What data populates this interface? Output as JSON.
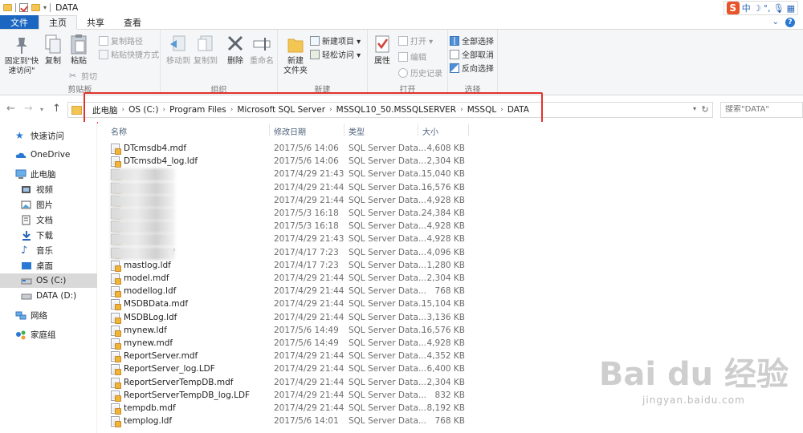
{
  "window": {
    "title": "DATA"
  },
  "tabs": [
    {
      "label": "文件"
    },
    {
      "label": "主页"
    },
    {
      "label": "共享"
    },
    {
      "label": "查看"
    }
  ],
  "ribbon": {
    "clipboard": {
      "label": "剪贴板",
      "pin": "固定到\"快速访问\"",
      "copy": "复制",
      "paste": "粘贴",
      "copy_path": "复制路径",
      "paste_shortcut": "粘贴快捷方式",
      "cut": "剪切"
    },
    "organize": {
      "label": "组织",
      "move_to": "移动到",
      "copy_to": "复制到",
      "delete": "删除",
      "rename": "重命名"
    },
    "new": {
      "label": "新建",
      "new_folder": "新建\n文件夹",
      "new_item": "新建项目 ▾",
      "easy_access": "轻松访问 ▾"
    },
    "open": {
      "label": "打开",
      "properties": "属性",
      "open": "打开 ▾",
      "edit": "编辑",
      "history": "历史记录"
    },
    "select": {
      "label": "选择",
      "select_all": "全部选择",
      "select_none": "全部取消",
      "invert": "反向选择"
    }
  },
  "address": {
    "crumbs": [
      "此电脑",
      "OS (C:)",
      "Program Files",
      "Microsoft SQL Server",
      "MSSQL10_50.MSSQLSERVER",
      "MSSQL",
      "DATA"
    ]
  },
  "search": {
    "placeholder": "搜索\"DATA\""
  },
  "sidebar": {
    "items": [
      {
        "label": "快速访问",
        "icon": "star-icon"
      },
      {
        "label": "OneDrive",
        "icon": "cloud-icon"
      },
      {
        "label": "此电脑",
        "icon": "computer-icon"
      },
      {
        "label": "视频",
        "icon": "video-icon"
      },
      {
        "label": "图片",
        "icon": "picture-icon"
      },
      {
        "label": "文档",
        "icon": "document-icon"
      },
      {
        "label": "下载",
        "icon": "download-icon"
      },
      {
        "label": "音乐",
        "icon": "music-icon"
      },
      {
        "label": "桌面",
        "icon": "desktop-icon"
      },
      {
        "label": "OS (C:)",
        "icon": "drive-icon"
      },
      {
        "label": "DATA (D:)",
        "icon": "drive-icon"
      },
      {
        "label": "网络",
        "icon": "network-icon"
      },
      {
        "label": "家庭组",
        "icon": "homegroup-icon"
      }
    ]
  },
  "list": {
    "columns": {
      "name": "名称",
      "date": "修改日期",
      "type": "类型",
      "size": "大小"
    },
    "rows": [
      {
        "name": "DTcmsdb4.mdf",
        "date": "2017/5/6 14:06",
        "type": "SQL Server Data...",
        "size": "4,608 KB"
      },
      {
        "name": "DTcmsdb4_log.ldf",
        "date": "2017/5/6 14:06",
        "type": "SQL Server Data...",
        "size": "2,304 KB"
      },
      {
        "name": "ldf",
        "date": "2017/4/29 21:43",
        "type": "SQL Server Data...",
        "size": "15,040 KB",
        "blurred": true
      },
      {
        "name": "",
        "date": "2017/4/29 21:44",
        "type": "SQL Server Data...",
        "size": "16,576 KB",
        "blurred": true
      },
      {
        "name": "",
        "date": "2017/4/29 21:44",
        "type": "SQL Server Data...",
        "size": "4,928 KB",
        "blurred": true
      },
      {
        "name": "",
        "date": "2017/5/3 16:18",
        "type": "SQL Server Data...",
        "size": "24,384 KB",
        "blurred": true
      },
      {
        "name": "",
        "date": "2017/5/3 16:18",
        "type": "SQL Server Data...",
        "size": "4,928 KB",
        "blurred": true
      },
      {
        "name": "mdf",
        "date": "2017/4/29 21:43",
        "type": "SQL Server Data...",
        "size": "4,928 KB",
        "blurred": true
      },
      {
        "name": "ter.mdf",
        "date": "2017/4/17 7:23",
        "type": "SQL Server Data...",
        "size": "4,096 KB",
        "blurred": true
      },
      {
        "name": "mastlog.ldf",
        "date": "2017/4/17 7:23",
        "type": "SQL Server Data...",
        "size": "1,280 KB"
      },
      {
        "name": "model.mdf",
        "date": "2017/4/29 21:44",
        "type": "SQL Server Data...",
        "size": "2,304 KB"
      },
      {
        "name": "modellog.ldf",
        "date": "2017/4/29 21:44",
        "type": "SQL Server Data...",
        "size": "768 KB"
      },
      {
        "name": "MSDBData.mdf",
        "date": "2017/4/29 21:44",
        "type": "SQL Server Data...",
        "size": "15,104 KB"
      },
      {
        "name": "MSDBLog.ldf",
        "date": "2017/4/29 21:44",
        "type": "SQL Server Data...",
        "size": "3,136 KB"
      },
      {
        "name": "mynew.ldf",
        "date": "2017/5/6 14:49",
        "type": "SQL Server Data...",
        "size": "16,576 KB"
      },
      {
        "name": "mynew.mdf",
        "date": "2017/5/6 14:49",
        "type": "SQL Server Data...",
        "size": "4,928 KB"
      },
      {
        "name": "ReportServer.mdf",
        "date": "2017/4/29 21:44",
        "type": "SQL Server Data...",
        "size": "4,352 KB"
      },
      {
        "name": "ReportServer_log.LDF",
        "date": "2017/4/29 21:44",
        "type": "SQL Server Data...",
        "size": "6,400 KB"
      },
      {
        "name": "ReportServerTempDB.mdf",
        "date": "2017/4/29 21:44",
        "type": "SQL Server Data...",
        "size": "2,304 KB"
      },
      {
        "name": "ReportServerTempDB_log.LDF",
        "date": "2017/4/29 21:44",
        "type": "SQL Server Data...",
        "size": "832 KB"
      },
      {
        "name": "tempdb.mdf",
        "date": "2017/4/29 21:44",
        "type": "SQL Server Data...",
        "size": "8,192 KB"
      },
      {
        "name": "templog.ldf",
        "date": "2017/5/6 14:01",
        "type": "SQL Server Data...",
        "size": "768 KB"
      }
    ]
  },
  "ime": {
    "mode": "中"
  },
  "watermark": {
    "brand": "Bai du 经验",
    "url": "jingyan.baidu.com"
  },
  "colors": {
    "file_tab": "#1a66c1",
    "highlight": "#e0322d",
    "folder": "#f3c553"
  }
}
